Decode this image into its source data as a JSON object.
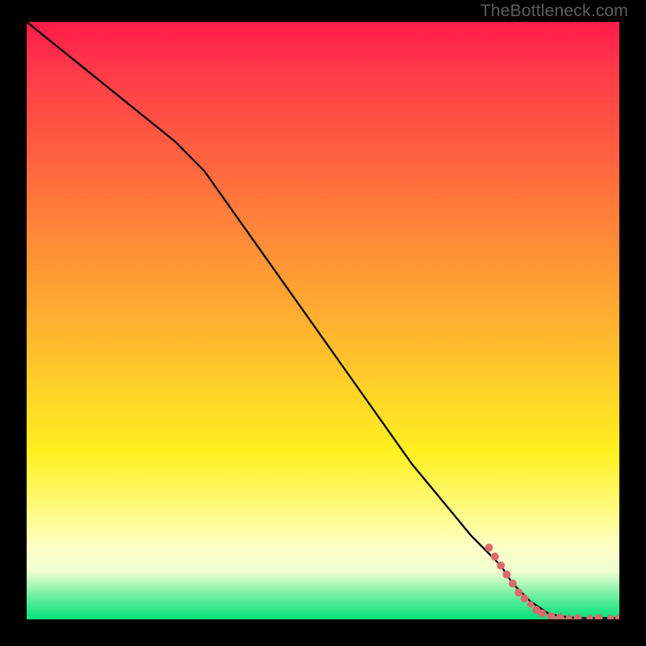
{
  "attribution": "TheBottleneck.com",
  "colors": {
    "gradient_top": "#ff1a4a",
    "gradient_mid_orange": "#ff8a38",
    "gradient_yellow": "#fff020",
    "gradient_bottom_green": "#00e07a",
    "line": "#000000",
    "marker": "#db6b6b"
  },
  "chart_data": {
    "type": "line",
    "title": "",
    "xlabel": "",
    "ylabel": "",
    "xlim": [
      0,
      100
    ],
    "ylim": [
      0,
      100
    ],
    "x": [
      0,
      5,
      10,
      15,
      20,
      25,
      30,
      35,
      40,
      45,
      50,
      55,
      60,
      65,
      70,
      75,
      80,
      82,
      85,
      88,
      90,
      92,
      94,
      96,
      98,
      100
    ],
    "y": [
      100,
      96,
      92,
      88,
      84,
      80,
      75,
      68,
      61,
      54,
      47,
      40,
      33,
      26,
      20,
      14,
      9,
      6,
      3,
      1,
      0.5,
      0.3,
      0.2,
      0.2,
      0.2,
      0.2
    ],
    "markers": [
      {
        "x": 78,
        "y": 12,
        "r": 5
      },
      {
        "x": 79,
        "y": 10.5,
        "r": 5
      },
      {
        "x": 80,
        "y": 9,
        "r": 5
      },
      {
        "x": 81,
        "y": 7.5,
        "r": 5
      },
      {
        "x": 82,
        "y": 6,
        "r": 5
      },
      {
        "x": 83,
        "y": 4.5,
        "r": 5
      },
      {
        "x": 84,
        "y": 3.5,
        "r": 5
      },
      {
        "x": 85,
        "y": 2.5,
        "r": 4
      },
      {
        "x": 86,
        "y": 1.6,
        "r": 5
      },
      {
        "x": 87,
        "y": 1.0,
        "r": 5
      },
      {
        "x": 88.5,
        "y": 0.5,
        "r": 5
      },
      {
        "x": 90,
        "y": 0.3,
        "r": 5
      },
      {
        "x": 91.5,
        "y": 0.25,
        "r": 4
      },
      {
        "x": 93,
        "y": 0.2,
        "r": 5
      },
      {
        "x": 95,
        "y": 0.2,
        "r": 4
      },
      {
        "x": 96.5,
        "y": 0.2,
        "r": 5
      },
      {
        "x": 98.5,
        "y": 0.2,
        "r": 4
      },
      {
        "x": 100,
        "y": 0.2,
        "r": 5
      }
    ]
  }
}
